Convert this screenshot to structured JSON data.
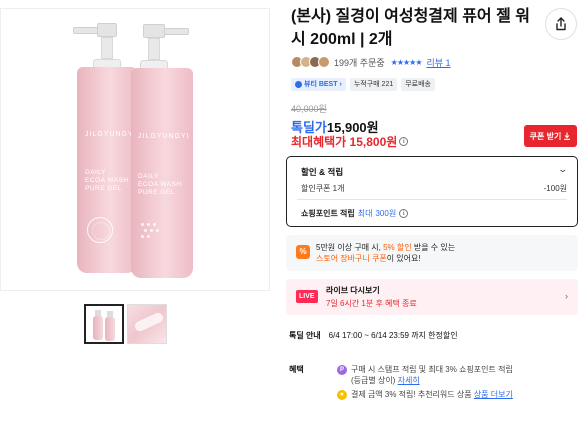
{
  "product": {
    "title": "(본사) 질경이 여성청결제 퓨어 젤 워시 200ml | 2개",
    "bottle_brand": "JILGYUNGYI",
    "bottle_label": [
      "DAILY",
      "ECOA WASH",
      "PURE GEL"
    ],
    "thumbnails": [
      {
        "name": "bottles-thumbnail",
        "active": true
      },
      {
        "name": "gel-texture-thumbnail",
        "active": false
      }
    ]
  },
  "share": {
    "icon": "share-icon"
  },
  "reviews": {
    "order_count": "199개 주문중",
    "stars": "★★★★★",
    "review_link": "리뷰 1",
    "avatar_colors": [
      "#b98a62",
      "#d4b28c",
      "#8b6a4f",
      "#c79a6e"
    ]
  },
  "badges": [
    {
      "label": "뷰티 BEST",
      "chevron": "›",
      "style": "blue"
    },
    {
      "label": "누적구매 221",
      "style": "grey"
    },
    {
      "label": "무료배송",
      "style": "grey"
    }
  ],
  "price": {
    "original": "40,000원",
    "deal_label": "톡딜가",
    "deal_value": "15,900원",
    "max_benefit": "최대혜택가 15,800원",
    "info_mark": "i",
    "coupon_button": "쿠폰 받기",
    "coupon_icon": "download-icon"
  },
  "discount_box": {
    "heading": "할인 & 적립",
    "coupon_label": "할인쿠폰 1개",
    "coupon_value": "-100원",
    "points_label": "쇼핑포인트 적립",
    "points_max_prefix": "최대",
    "points_value": "300원",
    "chevron": "⌄",
    "info_mark": "i"
  },
  "promo": {
    "icon_text": "%",
    "line1_a": "5만원 이상 구매 시,",
    "line1_b": "5% 할인",
    "line1_c": "받을 수 있는",
    "line2_a": "스토어 장바구니 쿠폰",
    "line2_b": "이 있어요!"
  },
  "live": {
    "tag": "LIVE",
    "title": "라이브 다시보기",
    "subtitle": "7일 6시간 1분 후 혜택 종료",
    "arrow": "›"
  },
  "special": {
    "key": "톡딜 안내",
    "value": "6/4 17:00 ~ 6/14 23:59 까지 한정할인"
  },
  "benefits": {
    "key": "혜택",
    "items": [
      {
        "icon": "P",
        "text_a": "구매 시 스탬프 적립 및 최대 3% 쇼핑포인트 적립",
        "text_b": "(등급별 상이)",
        "link": "자세히"
      },
      {
        "icon": "★",
        "text_a": "결제 금액 3% 적립! 추천리워드 상품",
        "link": "상품 더보기"
      }
    ]
  },
  "colors": {
    "accent_blue": "#2d6cf0",
    "accent_red": "#e8262d",
    "live_pink": "#ff2a55",
    "promo_orange": "#ff7a1a",
    "bottle_pink": "#f3ccd2"
  }
}
